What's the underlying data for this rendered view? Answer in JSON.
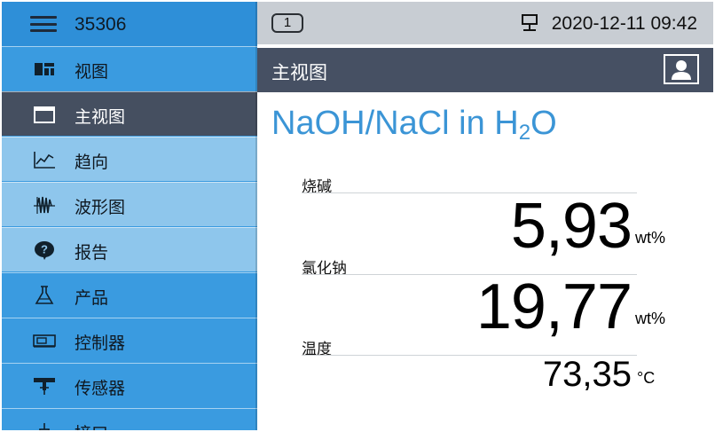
{
  "header": {
    "device_id": "35306",
    "screen_number": "1",
    "datetime": "2020-12-11 09:42"
  },
  "sidebar": {
    "items": [
      {
        "label": "视图",
        "icon": "dashboard-view-icon"
      },
      {
        "label": "主视图",
        "icon": "window-icon"
      },
      {
        "label": "趋向",
        "icon": "trend-chart-icon"
      },
      {
        "label": "波形图",
        "icon": "waveform-icon"
      },
      {
        "label": "报告",
        "icon": "question-bubble-icon"
      },
      {
        "label": "产品",
        "icon": "flask-icon"
      },
      {
        "label": "控制器",
        "icon": "controller-icon"
      },
      {
        "label": "传感器",
        "icon": "sensor-icon"
      },
      {
        "label": "接口",
        "icon": "interface-icon"
      }
    ]
  },
  "view": {
    "title": "主视图",
    "sample_name_main": "NaOH/NaCl in H",
    "sample_name_sub": "2",
    "sample_name_tail": "O"
  },
  "measurements": [
    {
      "label": "烧碱",
      "value": "5,93",
      "unit": "wt%"
    },
    {
      "label": "氯化钠",
      "value": "19,77",
      "unit": "wt%"
    },
    {
      "label": "温度",
      "value": "73,35",
      "unit": "°C"
    }
  ],
  "colors": {
    "sidebar_blue": "#3a9be0",
    "sidebar_light": "#8ec6ec",
    "active_dark": "#454f60",
    "accent_text": "#3b95d6",
    "topbar_gray": "#c8cdd3"
  }
}
